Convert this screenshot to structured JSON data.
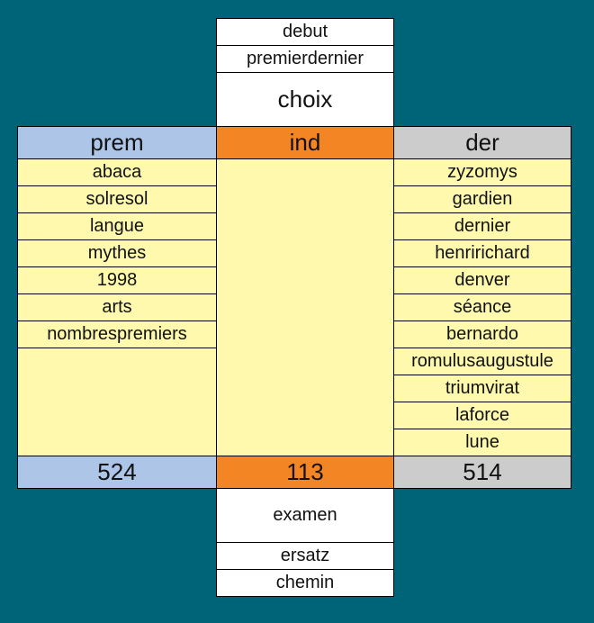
{
  "top": {
    "items": [
      "debut",
      "premierdernier",
      "choix"
    ]
  },
  "headers": {
    "prem": "prem",
    "ind": "ind",
    "der": "der"
  },
  "prem_list": [
    "abaca",
    "solresol",
    "langue",
    "mythes",
    "1998",
    "arts",
    "nombrespremiers"
  ],
  "ind_list": [],
  "der_list": [
    "zyzomys",
    "gardien",
    "dernier",
    "henririchard",
    "denver",
    "séance",
    "bernardo",
    "romulusaugustule",
    "triumvirat",
    "laforce",
    "lune"
  ],
  "totals": {
    "prem": "524",
    "ind": "113",
    "der": "514"
  },
  "bottom": {
    "items": [
      "examen",
      "ersatz",
      "chemin"
    ]
  },
  "colors": {
    "background": "#006478",
    "prem": "#adc5e7",
    "ind": "#f38524",
    "der": "#cccccc",
    "list": "#fff9ae"
  }
}
